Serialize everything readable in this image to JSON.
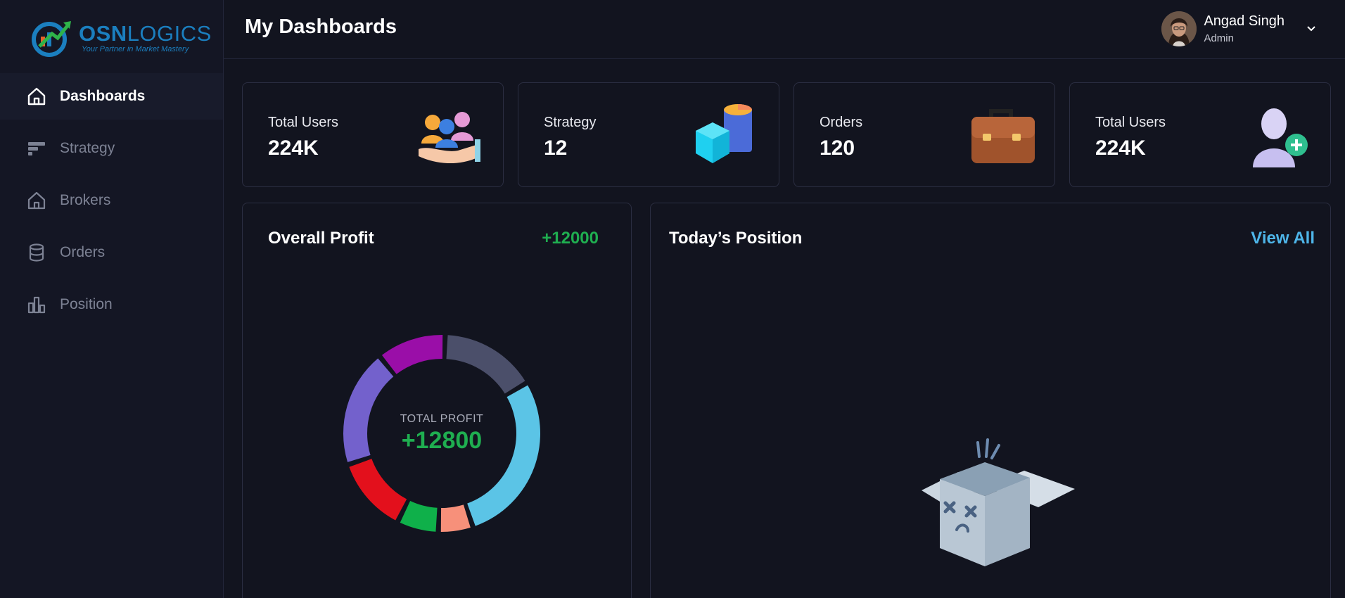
{
  "brand": {
    "name_part1": "OSN",
    "name_part2": "LOGICS",
    "tagline": "Your Partner in Market Mastery",
    "color": "#1b7fbf"
  },
  "sidebar": {
    "items": [
      {
        "label": "Dashboards",
        "icon": "home-icon",
        "active": true
      },
      {
        "label": "Strategy",
        "icon": "strategy-icon",
        "active": false
      },
      {
        "label": "Brokers",
        "icon": "home-outline-icon",
        "active": false
      },
      {
        "label": "Orders",
        "icon": "database-icon",
        "active": false
      },
      {
        "label": "Position",
        "icon": "bar-chart-icon",
        "active": false
      }
    ]
  },
  "header": {
    "title": "My Dashboards",
    "user": {
      "name": "Angad Singh",
      "role": "Admin"
    }
  },
  "stats": [
    {
      "label": "Total Users",
      "value": "224K",
      "icon": "users-hand-icon"
    },
    {
      "label": "Strategy",
      "value": "12",
      "icon": "cubes-icon"
    },
    {
      "label": "Orders",
      "value": "120",
      "icon": "briefcase-icon"
    },
    {
      "label": "Total Users",
      "value": "224K",
      "icon": "add-user-icon"
    }
  ],
  "profit_panel": {
    "title": "Overall Profit",
    "metric": "+12000",
    "center_label": "TOTAL PROFIT",
    "center_value": "+12800"
  },
  "position_panel": {
    "title": "Today’s Position",
    "link": "View All",
    "empty_icon": "empty-box-icon"
  },
  "colors": {
    "background": "#12141f",
    "positive": "#1fae50",
    "link": "#4eb5e8"
  },
  "chart_data": {
    "type": "pie",
    "segments": [
      {
        "value": 14,
        "color": "#4b4f6a"
      },
      {
        "value": 25,
        "color": "#5bc4e6"
      },
      {
        "value": 5,
        "color": "#f7907a"
      },
      {
        "value": 6,
        "color": "#0fb04a"
      },
      {
        "value": 11,
        "color": "#e3101c"
      },
      {
        "value": 17,
        "color": "#7361cc"
      },
      {
        "value": 10,
        "color": "#9a0ea8"
      }
    ]
  }
}
